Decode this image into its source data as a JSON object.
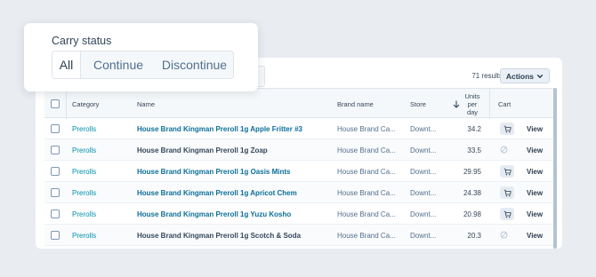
{
  "popover": {
    "title": "Carry status",
    "options": [
      "All",
      "Continue",
      "Discontinue"
    ],
    "selected": "All"
  },
  "toolbar": {
    "results": "71 results",
    "actions_label": "Actions"
  },
  "table": {
    "headers": {
      "category": "Category",
      "name": "Name",
      "brand": "Brand name",
      "store": "Store",
      "units_line1": "Units",
      "units_line2": "per",
      "units_line3": "day",
      "cart": "Cart"
    },
    "rows": [
      {
        "category": "Prerolls",
        "name": "House Brand Kingman Preroll 1g Apple Fritter #3",
        "brand": "House Brand Ca...",
        "store": "Downt...",
        "units": "34.2",
        "cart": "cart",
        "view": "View",
        "name_linked": true
      },
      {
        "category": "Prerolls",
        "name": "House Brand Kingman Preroll 1g Zoap",
        "brand": "House Brand Ca...",
        "store": "Downt...",
        "units": "33.5",
        "cart": "none",
        "view": "View",
        "name_linked": false
      },
      {
        "category": "Prerolls",
        "name": "House Brand Kingman Preroll 1g Oasis Mints",
        "brand": "House Brand Ca...",
        "store": "Downt...",
        "units": "29.95",
        "cart": "cart",
        "view": "View",
        "name_linked": true
      },
      {
        "category": "Prerolls",
        "name": "House Brand Kingman Preroll 1g Apricot Chem",
        "brand": "House Brand Ca...",
        "store": "Downt...",
        "units": "24.38",
        "cart": "cart",
        "view": "View",
        "name_linked": true
      },
      {
        "category": "Prerolls",
        "name": "House Brand Kingman Preroll 1g Yuzu Kosho",
        "brand": "House Brand Ca...",
        "store": "Downt...",
        "units": "20.98",
        "cart": "cart",
        "view": "View",
        "name_linked": true
      },
      {
        "category": "Prerolls",
        "name": "House Brand Kingman Preroll 1g Scotch & Soda",
        "brand": "House Brand Ca...",
        "store": "Downt...",
        "units": "20.3",
        "cart": "none",
        "view": "View",
        "name_linked": false
      }
    ]
  },
  "icons": {
    "sort": "arrow-down-icon",
    "cart": "shopping-cart-icon",
    "no_cart": "prohibited-icon",
    "dropdown": "chevron-down-icon"
  },
  "colors": {
    "link": "#0b6e99",
    "category": "#0091ae",
    "background": "#e9ecf1"
  }
}
